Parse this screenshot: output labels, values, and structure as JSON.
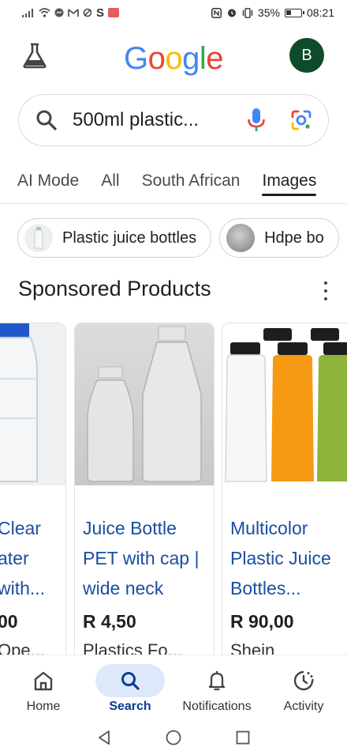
{
  "status_bar": {
    "left_icons": [
      "signal-icon",
      "wifi-icon",
      "messenger-icon",
      "gmail-icon",
      "sync-icon",
      "s-app-icon",
      "notification-badge-icon"
    ],
    "s_letter": "S",
    "battery_percent": "35%",
    "battery_level": 0.35,
    "time": "08:21",
    "right_icons": [
      "nfc-icon",
      "alarm-icon",
      "vibrate-icon",
      "battery-icon"
    ]
  },
  "header": {
    "logo_text": "Google",
    "logo_colors": [
      "#4285F4",
      "#EA4335",
      "#FBBC05",
      "#4285F4",
      "#34A853",
      "#EA4335"
    ],
    "avatar_letter": "B",
    "avatar_color": "#0e4b2b"
  },
  "search": {
    "query": "500ml plastic..."
  },
  "tabs": [
    {
      "label": "AI Mode",
      "active": false
    },
    {
      "label": "All",
      "active": false
    },
    {
      "label": "South African",
      "active": false
    },
    {
      "label": "Images",
      "active": true
    }
  ],
  "chips": [
    {
      "label": "Plastic juice bottles"
    },
    {
      "label": "Hdpe bo"
    }
  ],
  "sponsored": {
    "title": "Sponsored Products",
    "products": [
      {
        "title": "Clear\nater\nwith...",
        "price": "00",
        "seller": "Ope..."
      },
      {
        "title": "Juice Bottle PET with cap | wide neck",
        "price": "R 4,50",
        "seller": "Plastics Fo..."
      },
      {
        "title": "Multicolor Plastic Juice Bottles...",
        "price": "R 90,00",
        "seller": "Shein"
      }
    ]
  },
  "bottom_nav": [
    {
      "label": "Home",
      "icon": "home-icon",
      "active": false
    },
    {
      "label": "Search",
      "icon": "search-icon",
      "active": true
    },
    {
      "label": "Notifications",
      "icon": "bell-icon",
      "active": false
    },
    {
      "label": "Activity",
      "icon": "activity-icon",
      "active": false
    }
  ],
  "system_nav": [
    "back-icon",
    "home-circle-icon",
    "recents-icon"
  ],
  "colors": {
    "link_blue": "#1a4ea0",
    "active_pill": "#dde8fb"
  }
}
